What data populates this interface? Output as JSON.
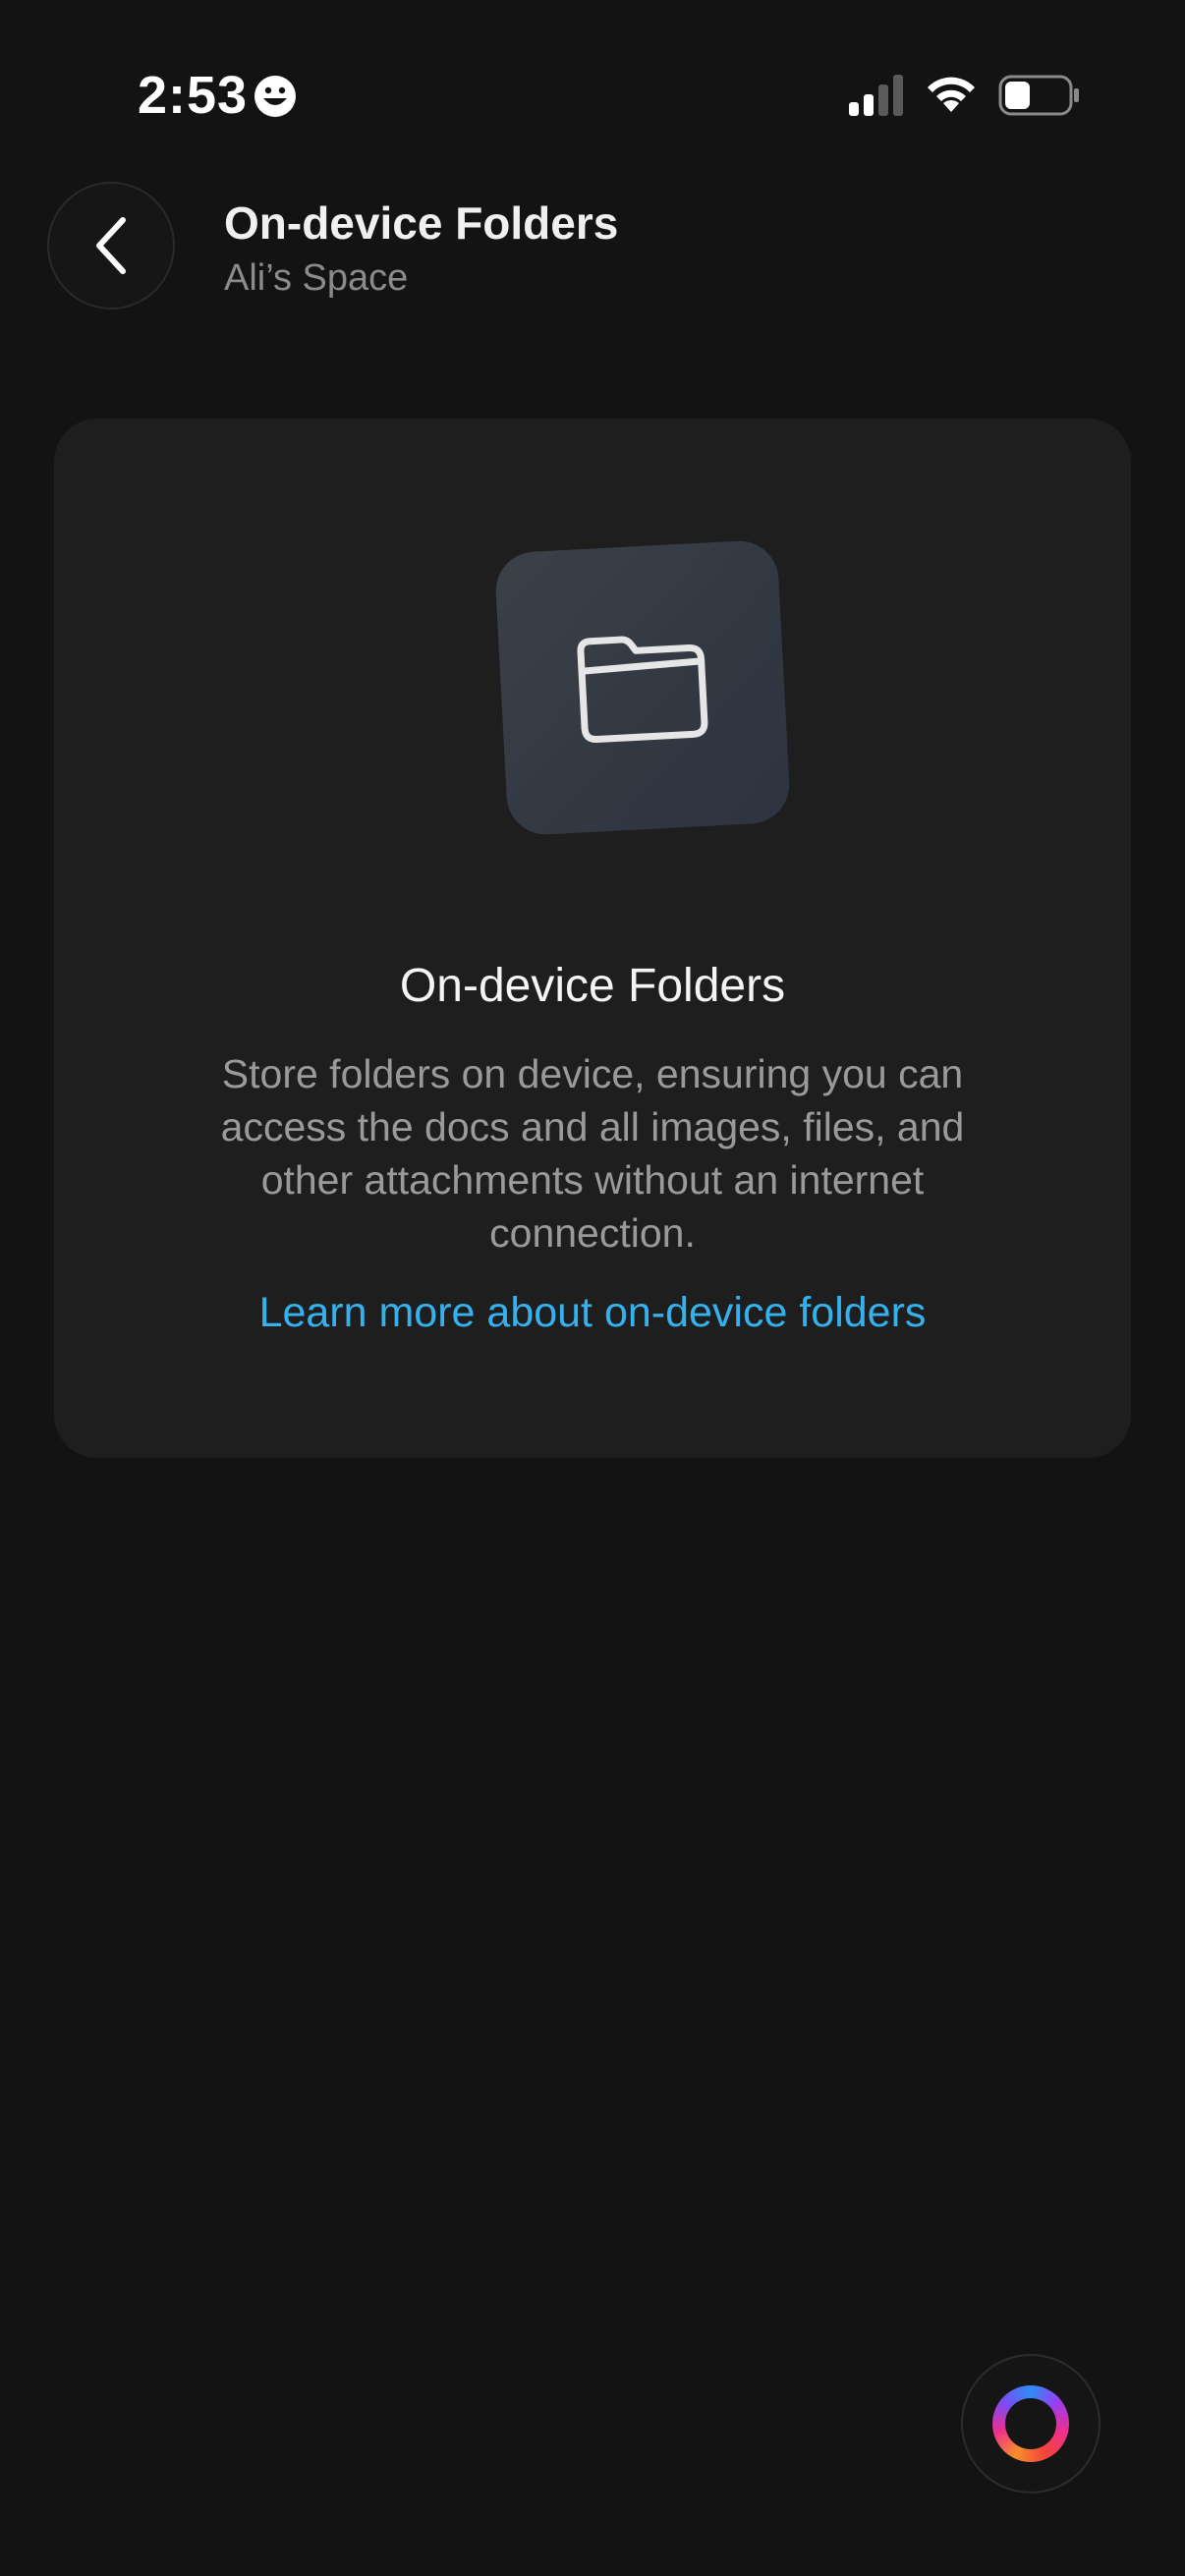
{
  "status_bar": {
    "time": "2:53",
    "icons": [
      "smiley-face-icon",
      "cellular-signal-icon",
      "wifi-icon",
      "battery-icon"
    ],
    "battery_level": 0.35
  },
  "header": {
    "back_icon": "chevron-left-icon",
    "title": "On-device Folders",
    "subtitle": "Ali’s Space"
  },
  "card": {
    "icon": "folder-icon",
    "title": "On-device Folders",
    "description": "Store folders on device, ensuring you can access the docs and all images, files, and other attachments without an internet connection.",
    "link_label": "Learn more about on-device folders"
  },
  "fab": {
    "icon": "assistant-ring-icon"
  },
  "colors": {
    "background": "#131313",
    "card": "#1e1e1e",
    "link": "#35b2ee"
  }
}
